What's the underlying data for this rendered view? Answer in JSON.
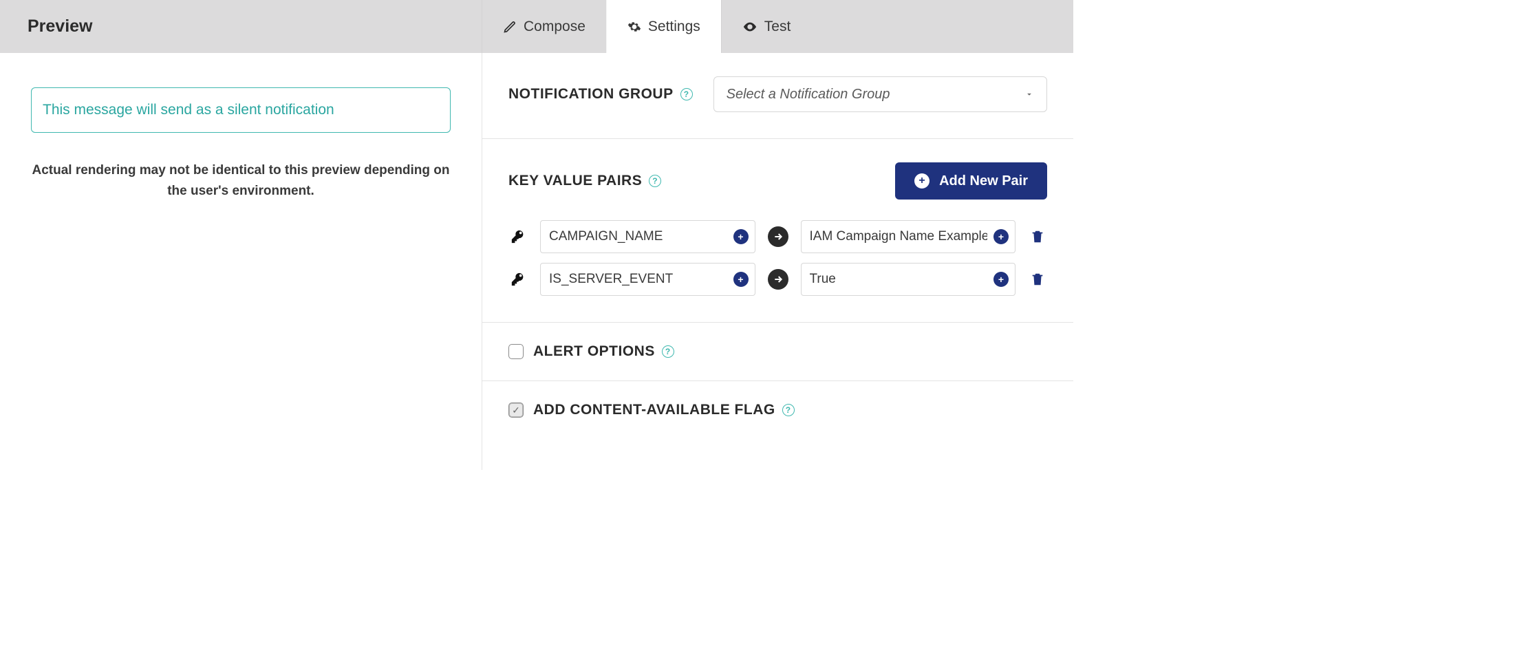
{
  "header": {
    "title": "Preview",
    "tabs": {
      "compose": "Compose",
      "settings": "Settings",
      "test": "Test"
    }
  },
  "preview": {
    "silent_notice": "This message will send as a silent notification",
    "caption": "Actual rendering may not be identical to this preview depending on the user's environment."
  },
  "settings": {
    "notification_group": {
      "label": "NOTIFICATION GROUP",
      "placeholder": "Select a Notification Group"
    },
    "kv": {
      "label": "KEY VALUE PAIRS",
      "add_button": "Add New Pair",
      "pairs": [
        {
          "key": "CAMPAIGN_NAME",
          "value": "IAM Campaign Name Example"
        },
        {
          "key": "IS_SERVER_EVENT",
          "value": "True"
        }
      ]
    },
    "alert_options": {
      "label": "ALERT OPTIONS",
      "checked": false
    },
    "content_available": {
      "label": "ADD CONTENT-AVAILABLE FLAG",
      "checked": true
    }
  }
}
